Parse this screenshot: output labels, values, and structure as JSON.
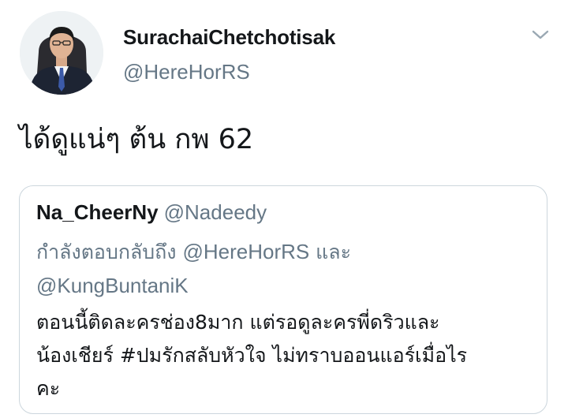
{
  "tweet": {
    "display_name": "SurachaiChetchotisak",
    "handle": "@HereHorRS",
    "text": "ได้ดูแน่ๆ ต้น กพ 62",
    "menu_icon": "chevron-down-icon",
    "avatar_icon": "profile-photo"
  },
  "quoted_tweet": {
    "display_name": "Na_CheerNy",
    "handle": "@Nadeedy",
    "replying_to_prefix": "กำลังตอบกลับถึง",
    "replying_to_user1": "@HereHorRS",
    "replying_to_joiner": "และ",
    "replying_to_user2": "@KungBuntaniK",
    "body_line1": "ตอนนี้ติดละครช่อง8มาก แต่รอดูละครพี่ดริวและ",
    "body_line2_prefix": "น้องเชียร์",
    "body_hashtag": "#ปมรักสลับหัวใจ",
    "body_line2_suffix": "ไม่ทราบออนแอร์เมื่อไร",
    "body_line3": "คะ"
  },
  "colors": {
    "text_primary": "#14171a",
    "text_secondary": "#657786",
    "border": "#ccd6dd",
    "background": "#ffffff"
  }
}
